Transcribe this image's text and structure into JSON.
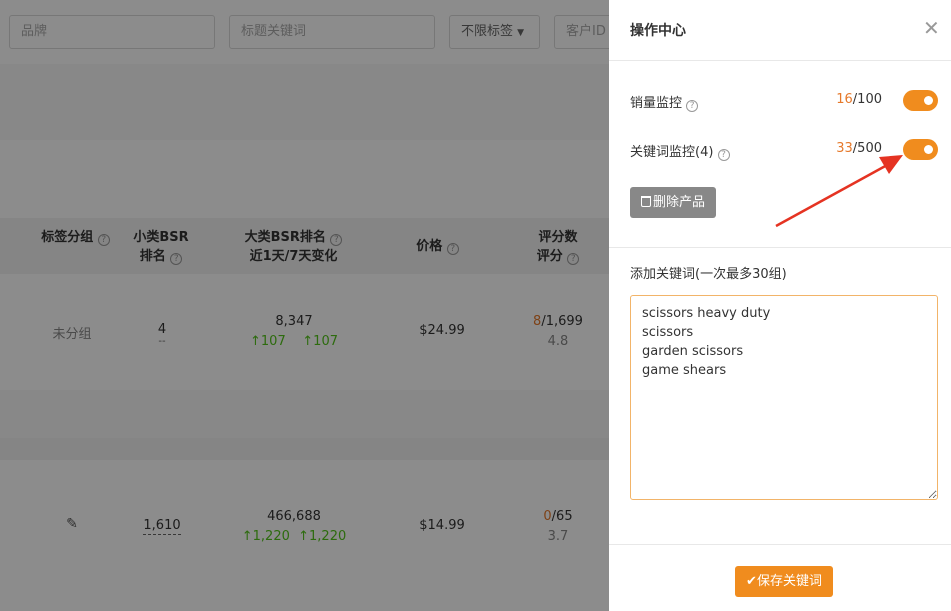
{
  "filters": {
    "brand_placeholder": "品牌",
    "keyword_placeholder": "标题关键词",
    "tag_select": "不限标签",
    "customer_id_placeholder": "客户ID"
  },
  "table": {
    "headers": [
      {
        "line1": "标签分组",
        "line2": ""
      },
      {
        "line1": "小类BSR",
        "line2": "排名"
      },
      {
        "line1": "大类BSR排名",
        "line2": "近1天/7天变化"
      },
      {
        "line1": "价格",
        "line2": ""
      },
      {
        "line1": "评分数",
        "line2": "评分"
      }
    ],
    "rows": [
      {
        "group": "未分组",
        "small_bsr": "4",
        "small_bsr_sub": "--",
        "big_bsr": "8,347",
        "change_1d": "107",
        "change_7d": "107",
        "price": "$24.99",
        "rating_count_highlight": "8",
        "rating_count_total": "/1,699",
        "rating": "4.8"
      },
      {
        "group": "",
        "small_bsr": "1,610",
        "small_bsr_sub": "",
        "big_bsr": "466,688",
        "change_1d": "1,220",
        "change_7d": "1,220",
        "price": "$14.99",
        "rating_count_highlight": "0",
        "rating_count_total": "/65",
        "rating": "3.7"
      }
    ]
  },
  "panel": {
    "title": "操作中心",
    "sales_monitor": {
      "label": "销量监控",
      "used": "16",
      "limit": "/100",
      "enabled": true
    },
    "keyword_monitor": {
      "label": "关键词监控(4)",
      "used": "33",
      "limit": "/500",
      "enabled": true
    },
    "delete_label": "删除产品",
    "add_keywords_label": "添加关键词(一次最多30组)",
    "keywords_value": "scissors heavy duty\nscissors\ngarden scissors\ngame shears",
    "save_label": "保存关键词"
  },
  "colors": {
    "accent": "#f08c1e",
    "count_highlight": "#e6792b",
    "up": "#52c41a",
    "annotation_arrow": "#e53322"
  }
}
